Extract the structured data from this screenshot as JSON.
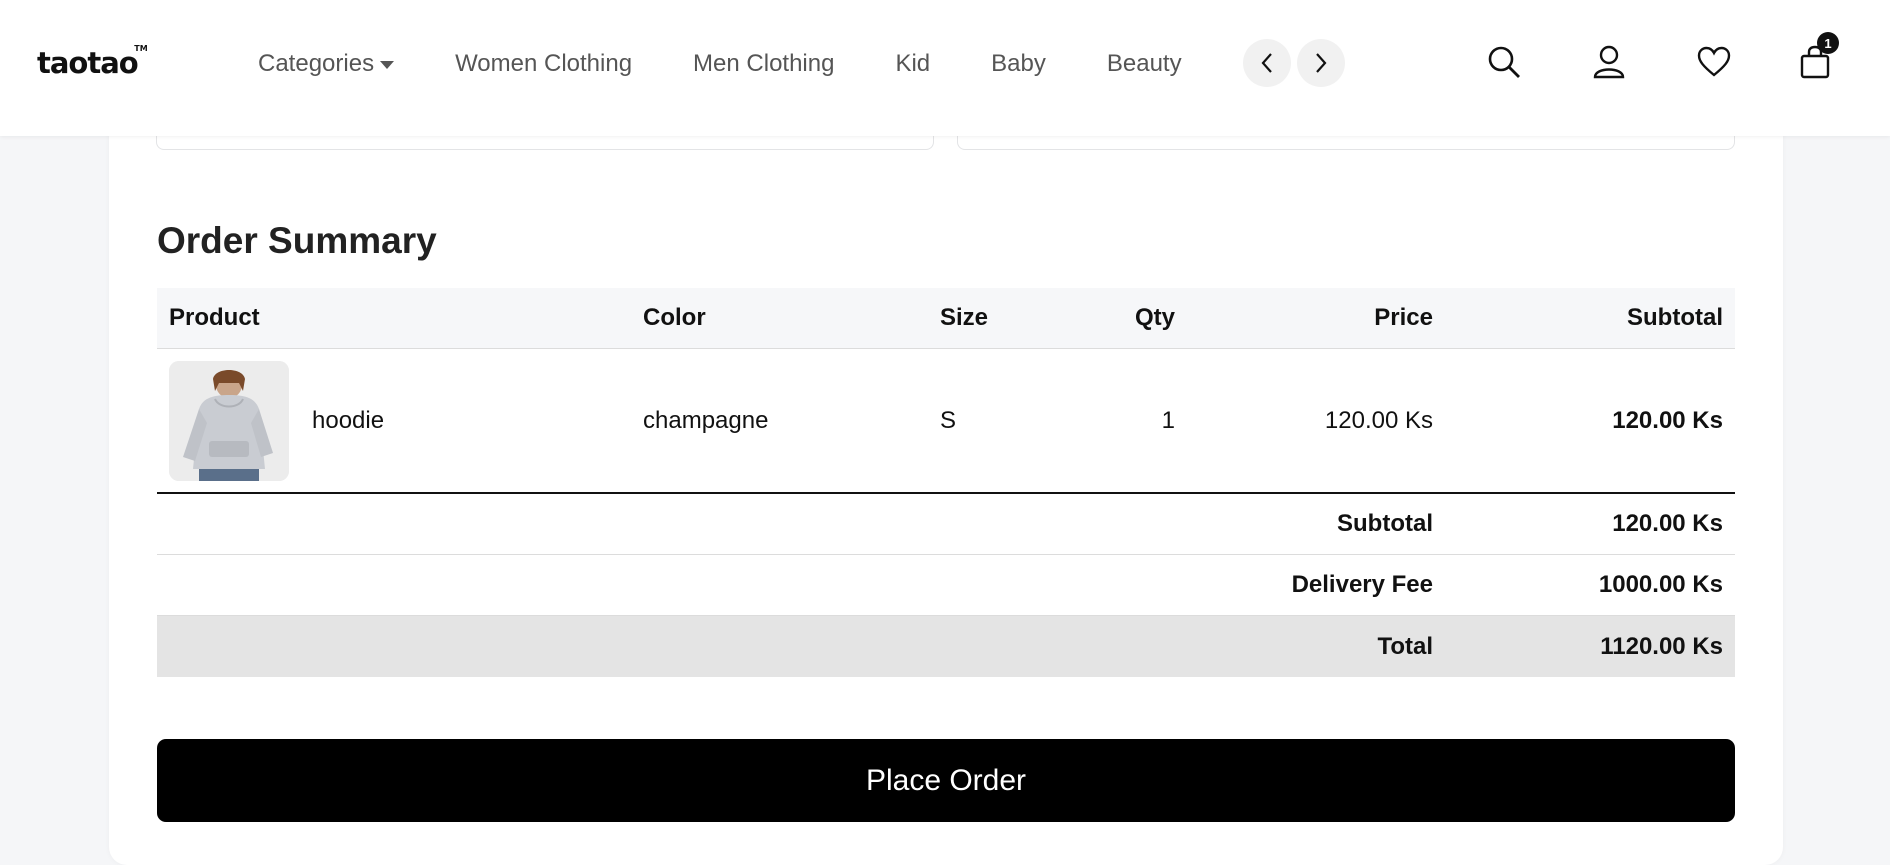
{
  "header": {
    "logo": "taotao",
    "logo_tm": "TM",
    "nav": [
      "Categories",
      "Women Clothing",
      "Men Clothing",
      "Kid",
      "Baby",
      "Beauty"
    ],
    "cart_count": "1"
  },
  "order_summary": {
    "title": "Order Summary",
    "columns": {
      "product": "Product",
      "color": "Color",
      "size": "Size",
      "qty": "Qty",
      "price": "Price",
      "subtotal": "Subtotal"
    },
    "items": [
      {
        "name": "hoodie",
        "color": "champagne",
        "size": "S",
        "qty": "1",
        "price": "120.00 Ks",
        "subtotal": "120.00 Ks"
      }
    ],
    "subtotal_label": "Subtotal",
    "subtotal_value": "120.00 Ks",
    "delivery_label": "Delivery Fee",
    "delivery_value": "1000.00 Ks",
    "total_label": "Total",
    "total_value": "1120.00 Ks"
  },
  "place_order_label": "Place Order",
  "icons": [
    "search-icon",
    "user-icon",
    "heart-icon",
    "bag-icon",
    "chevron-left-icon",
    "chevron-right-icon"
  ]
}
